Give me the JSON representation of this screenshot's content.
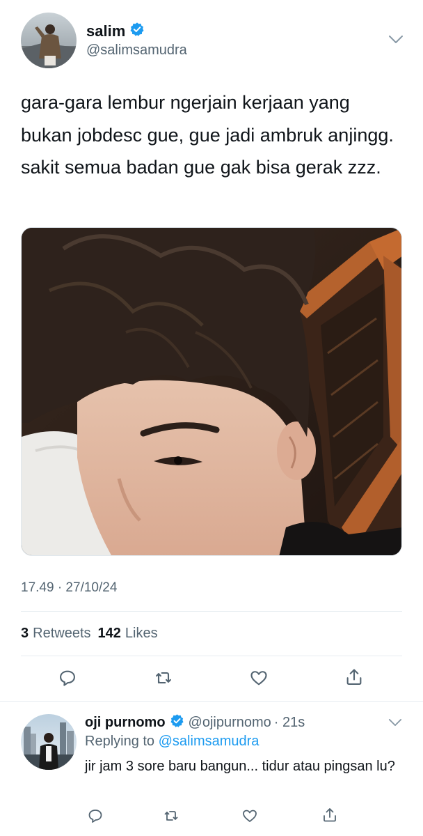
{
  "tweet": {
    "author": {
      "name": "salim",
      "handle": "@salimsamudra",
      "verified": true
    },
    "text": "gara-gara lembur ngerjain kerjaan yang bukan jobdesc gue, gue jadi ambruk anjingg. sakit semua badan gue gak bisa gerak zzz.",
    "timestamp": "17.49 · 27/10/24",
    "stats": {
      "retweets_count": "3",
      "retweets_label": "Retweets",
      "likes_count": "142",
      "likes_label": "Likes"
    },
    "actions": [
      "reply-icon",
      "retweet-icon",
      "like-icon",
      "share-icon"
    ],
    "menu_icon": "chevron-down-icon"
  },
  "reply": {
    "author": {
      "name": "oji purnomo",
      "handle": "@ojipurnomo",
      "verified": true,
      "time": "· 21s"
    },
    "replying_to_label": "Replying to",
    "replying_to_handle": "@salimsamudra",
    "text": "jir jam 3 sore baru bangun... tidur atau pingsan lu?",
    "actions": [
      "reply-icon",
      "retweet-icon",
      "like-icon",
      "share-icon"
    ]
  },
  "colors": {
    "text": "#0f1419",
    "secondary": "#536471",
    "accent": "#1d9bf0",
    "divider": "#e6ecf0"
  }
}
